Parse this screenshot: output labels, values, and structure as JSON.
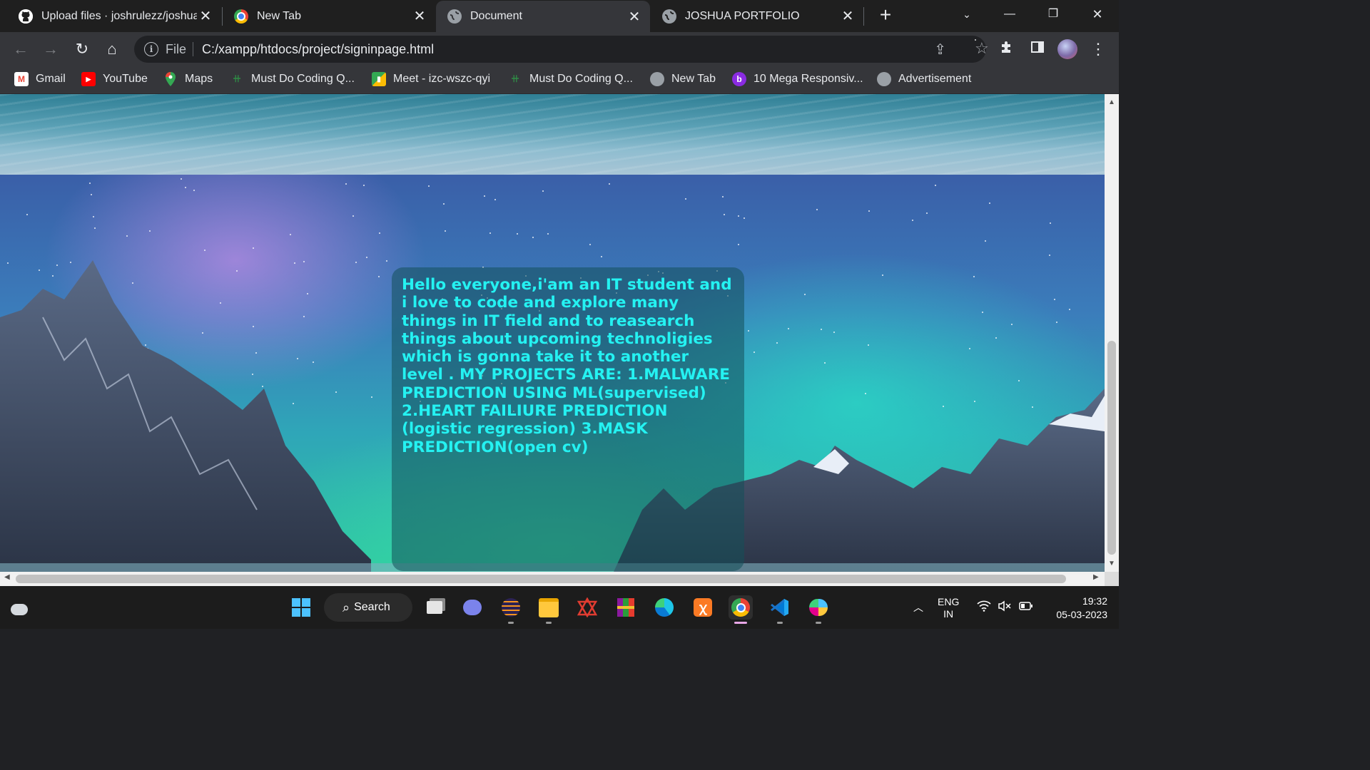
{
  "tabs": [
    {
      "title": "Upload files · joshrulezz/joshua",
      "active": false,
      "icon": "github-icon"
    },
    {
      "title": "New Tab",
      "active": false,
      "icon": "chrome-icon"
    },
    {
      "title": "Document",
      "active": true,
      "icon": "globe-icon"
    },
    {
      "title": "JOSHUA PORTFOLIO",
      "active": false,
      "icon": "globe-icon"
    }
  ],
  "toolbar": {
    "scheme": "File",
    "url": "C:/xampp/htdocs/project/signinpage.html"
  },
  "bookmarks": [
    {
      "label": "Gmail",
      "icon": "gmail-icon"
    },
    {
      "label": "YouTube",
      "icon": "youtube-icon"
    },
    {
      "label": "Maps",
      "icon": "maps-icon"
    },
    {
      "label": "Must Do Coding Q...",
      "icon": "gfg-icon"
    },
    {
      "label": "Meet - izc-wszc-qyi",
      "icon": "meet-icon"
    },
    {
      "label": "Must Do Coding Q...",
      "icon": "gfg-icon"
    },
    {
      "label": "New Tab",
      "icon": "globe-icon"
    },
    {
      "label": "10 Mega Responsiv...",
      "icon": "bootstrap-icon"
    },
    {
      "label": "Advertisement",
      "icon": "globe-icon"
    }
  ],
  "page": {
    "card_text": "Hello everyone,i'am an IT student and i love to code and explore many things in IT field and to reasearch things about upcoming technoligies which is gonna take it to another level . MY PROJECTS ARE: 1.MALWARE PREDICTION USING ML(supervised) 2.HEART FAILIURE PREDICTION (logistic regression) 3.MASK PREDICTION(open cv)",
    "card_text_color": "#24f2f2"
  },
  "taskbar": {
    "search_label": "Search",
    "apps": [
      "windows-start-icon",
      "task-view-icon",
      "teams-chat-icon",
      "eclipse-icon",
      "file-explorer-icon",
      "network-tool-icon",
      "winrar-icon",
      "edge-icon",
      "xampp-icon",
      "chrome-icon",
      "vscode-icon",
      "paint-icon"
    ],
    "active_app": "chrome-icon",
    "language": "ENG",
    "region": "IN",
    "time": "19:32",
    "date": "05-03-2023"
  }
}
